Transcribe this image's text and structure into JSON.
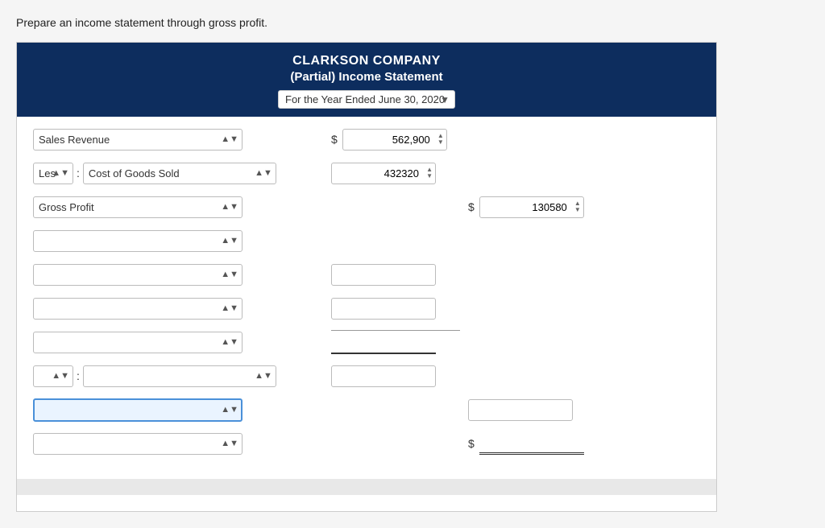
{
  "instruction": "Prepare an income statement through gross profit.",
  "header": {
    "company": "CLARKSON COMPANY",
    "subtitle": "(Partial) Income Statement",
    "date_label": "For the Year Ended June 30, 2020"
  },
  "rows": [
    {
      "id": "sales-revenue",
      "label": "Sales Revenue",
      "prefix": null,
      "separator": null,
      "dollar1": "$",
      "amount1": "562,900",
      "dollar2": null,
      "amount2": null
    },
    {
      "id": "cogs",
      "label": "Cost of Goods Sold",
      "prefix": "Less",
      "separator": ":",
      "dollar1": null,
      "amount1": "432320",
      "dollar2": null,
      "amount2": null
    },
    {
      "id": "gross-profit",
      "label": "Gross Profit",
      "prefix": null,
      "separator": null,
      "dollar1": "$",
      "amount1": null,
      "dollar2": "$",
      "amount2": "130580"
    }
  ],
  "empty_rows": {
    "middle": 4,
    "last_label": "",
    "last_amount": "",
    "final_dollar": "$",
    "final_amount": ""
  },
  "labels": {
    "sales_revenue": "Sales Revenue",
    "cogs": "Cost of Goods Sold",
    "gross_profit": "Gross Profit",
    "less": "Less"
  }
}
